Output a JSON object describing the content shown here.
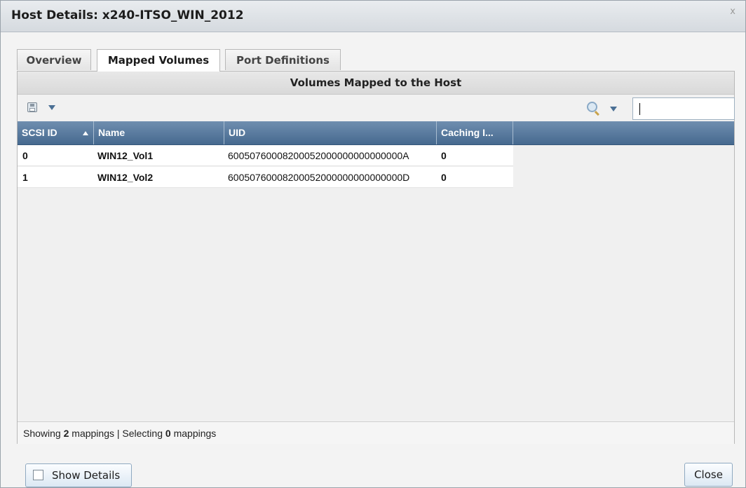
{
  "dialog": {
    "title": "Host Details: x240-ITSO_WIN_2012",
    "close_glyph": "x"
  },
  "tabs": [
    {
      "label": "Overview",
      "active": false
    },
    {
      "label": "Mapped Volumes",
      "active": true
    },
    {
      "label": "Port Definitions",
      "active": false
    }
  ],
  "section": {
    "header": "Volumes Mapped to the Host"
  },
  "toolbar": {
    "save_icon": "save-icon",
    "search_icon": "search-icon",
    "filter_value": ""
  },
  "table": {
    "columns": [
      "SCSI ID",
      "Name",
      "UID",
      "Caching I..."
    ],
    "sorted_column": "SCSI ID",
    "sort_direction": "ascending",
    "rows": [
      {
        "scsi_id": "0",
        "name": "WIN12_Vol1",
        "uid": "60050760008200052000000000000000A",
        "caching": "0"
      },
      {
        "scsi_id": "1",
        "name": "WIN12_Vol2",
        "uid": "60050760008200052000000000000000D",
        "caching": "0"
      }
    ]
  },
  "status": {
    "prefix": "Showing",
    "showing_count": "2",
    "middle": "mappings | Selecting",
    "selecting_count": "0",
    "suffix": "mappings"
  },
  "footer": {
    "show_details_label": "Show Details",
    "close_label": "Close"
  },
  "colors": {
    "grid_header": "#46698f",
    "accent_border": "#8fa9c1"
  }
}
